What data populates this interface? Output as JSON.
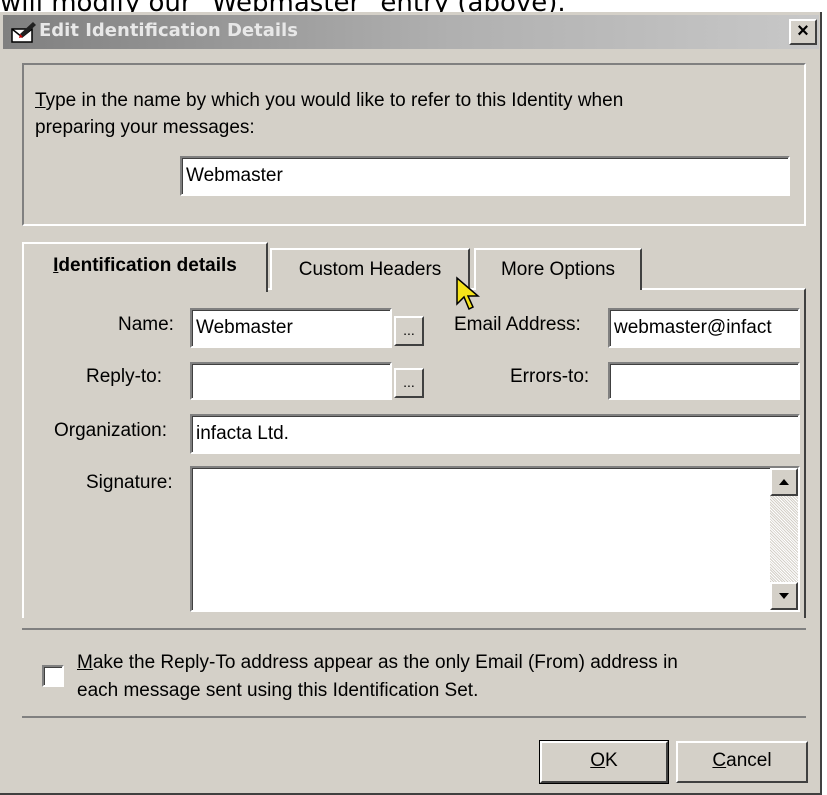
{
  "caption": {
    "text": "will modify our \"Webmaster\" entry (above)."
  },
  "window": {
    "title": "Edit Identification Details",
    "close_label": "×"
  },
  "identity": {
    "prompt_line1": "Type in the name by which you would like to refer to this Identity when",
    "prompt_line2": "preparing your messages:",
    "value": "Webmaster"
  },
  "tabs": [
    {
      "label": "Identification details",
      "active": true
    },
    {
      "label": "Custom Headers",
      "active": false
    },
    {
      "label": "More Options",
      "active": false
    }
  ],
  "form": {
    "name_label": "Name:",
    "name_value": "Webmaster",
    "browse_label": "...",
    "email_label": "Email Address:",
    "email_value": "webmaster@infact",
    "replyto_label": "Reply-to:",
    "replyto_value": "",
    "errorsto_label": "Errors-to:",
    "errorsto_value": "",
    "org_label": "Organization:",
    "org_value": "infacta Ltd.",
    "signature_label": "Signature:",
    "signature_value": ""
  },
  "checkbox": {
    "checked": false,
    "line1": "Make the Reply-To address appear as the only Email (From) address in",
    "line2": "each message sent using this Identification Set."
  },
  "buttons": {
    "ok": "OK",
    "cancel": "Cancel"
  },
  "icons": {
    "title": "envelope-pen-icon",
    "cursor": "mouse-pointer-icon",
    "scroll_up": "arrow-up-icon",
    "scroll_down": "arrow-down-icon"
  }
}
